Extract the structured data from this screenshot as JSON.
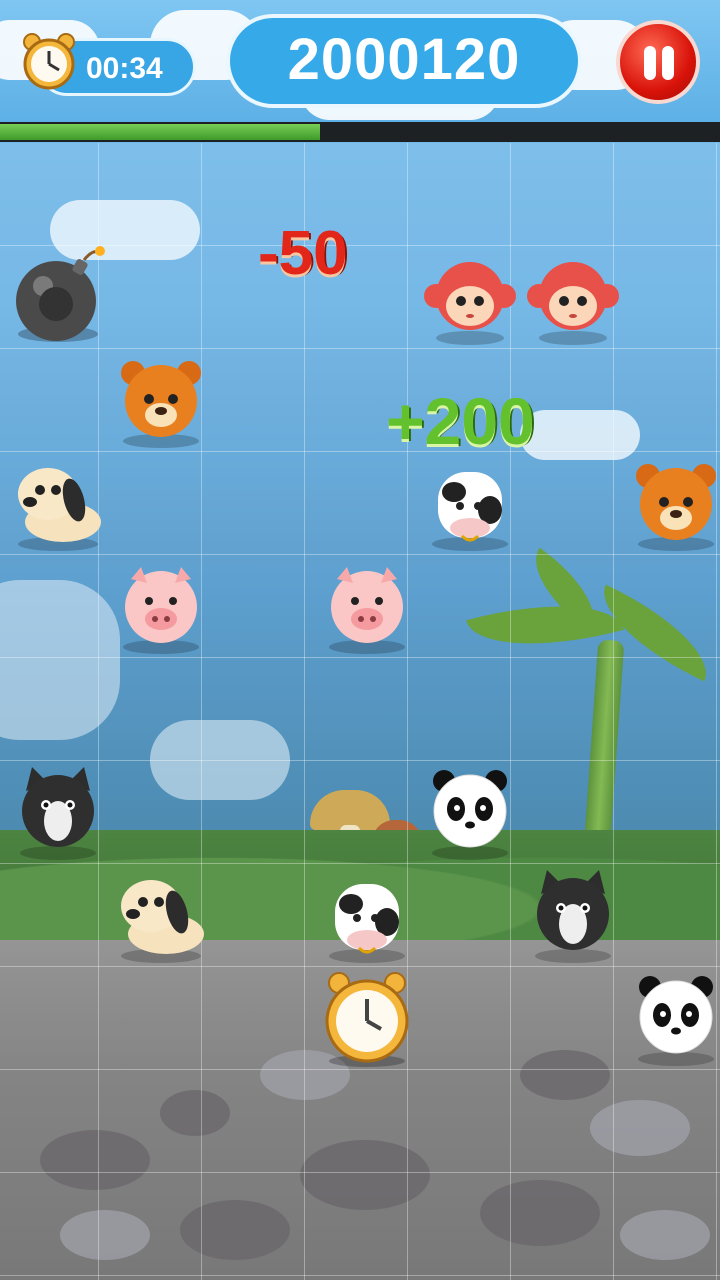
{
  "hud": {
    "timer": "00:34",
    "score": "2000120",
    "progress_fraction": 0.445
  },
  "popups": {
    "minus": "-50",
    "plus": "+200"
  },
  "pieces": [
    {
      "type": "bomb",
      "row": 1,
      "col": 0
    },
    {
      "type": "monkey",
      "row": 1,
      "col": 4
    },
    {
      "type": "monkey",
      "row": 1,
      "col": 5
    },
    {
      "type": "bear",
      "row": 2,
      "col": 1
    },
    {
      "type": "dog",
      "row": 3,
      "col": 0
    },
    {
      "type": "cow",
      "row": 3,
      "col": 4
    },
    {
      "type": "bear",
      "row": 3,
      "col": 6
    },
    {
      "type": "pig",
      "row": 4,
      "col": 1
    },
    {
      "type": "pig",
      "row": 4,
      "col": 3
    },
    {
      "type": "cat",
      "row": 6,
      "col": 0
    },
    {
      "type": "panda",
      "row": 6,
      "col": 4
    },
    {
      "type": "dog",
      "row": 7,
      "col": 1
    },
    {
      "type": "cow",
      "row": 7,
      "col": 3
    },
    {
      "type": "cat",
      "row": 7,
      "col": 5
    },
    {
      "type": "clock",
      "row": 8,
      "col": 3
    },
    {
      "type": "panda",
      "row": 8,
      "col": 6
    }
  ]
}
